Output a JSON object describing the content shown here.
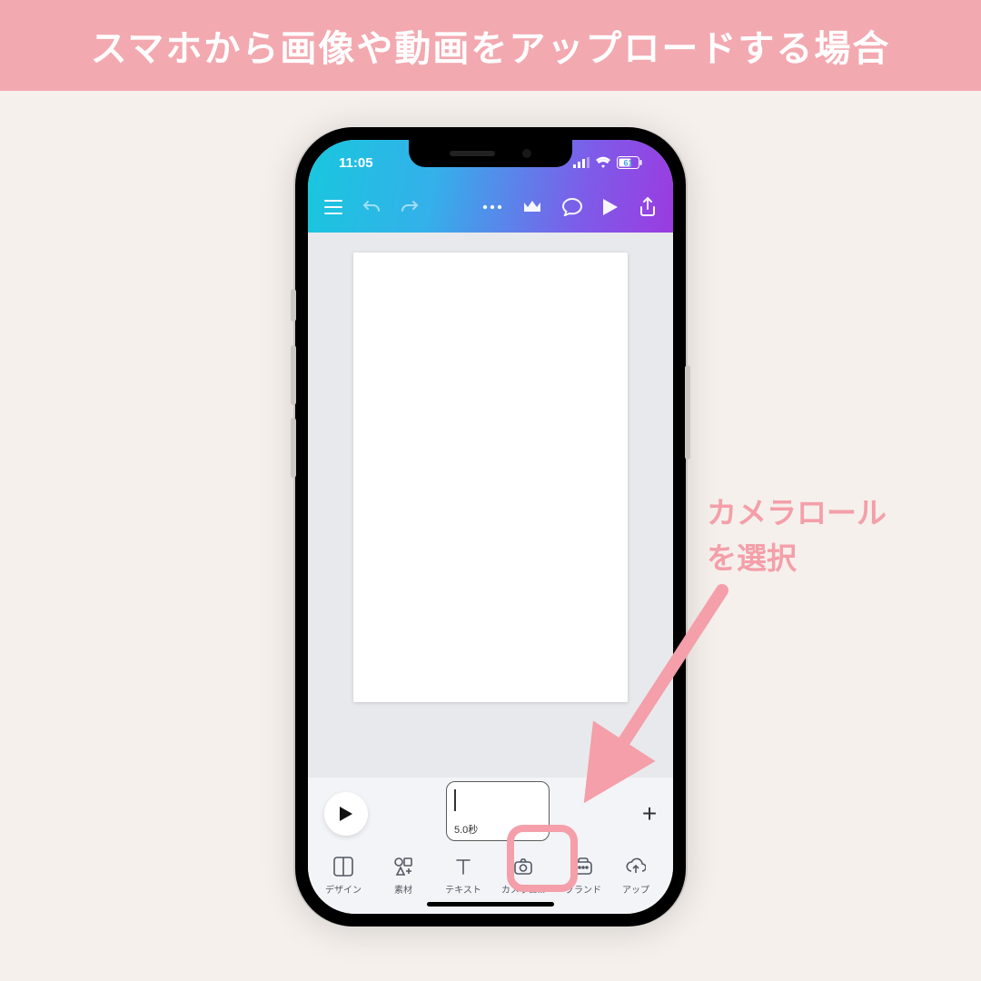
{
  "banner": {
    "title": "スマホから画像や動画をアップロードする場合"
  },
  "status": {
    "time": "11:05",
    "battery": "61"
  },
  "timeline": {
    "duration_label": "5.0秒",
    "add_label": "+"
  },
  "tabs": {
    "design": "デザイン",
    "elements": "素材",
    "text": "テキスト",
    "camera": "カメラロ...",
    "brand": "ブランド",
    "upload": "アップ"
  },
  "annotation": {
    "line1": "カメラロール",
    "line2": "を選択"
  },
  "colors": {
    "banner": "#f3a9b0",
    "accent": "#f49fa9",
    "page_bg": "#f5f0ec"
  }
}
